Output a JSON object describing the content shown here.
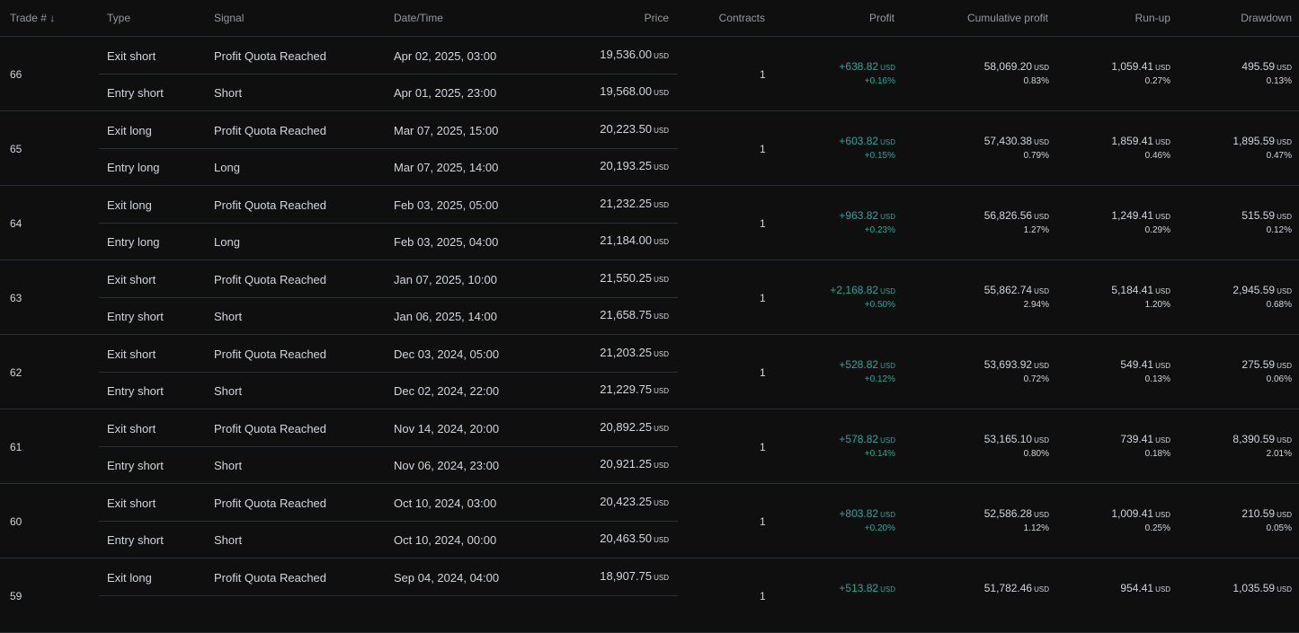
{
  "headers": {
    "trade": "Trade # ↓",
    "type": "Type",
    "signal": "Signal",
    "datetime": "Date/Time",
    "price": "Price",
    "contracts": "Contracts",
    "profit": "Profit",
    "cumulative": "Cumulative profit",
    "runup": "Run-up",
    "drawdown": "Drawdown"
  },
  "currency": "USD",
  "trades": [
    {
      "num": "66",
      "exit": {
        "type": "Exit short",
        "signal": "Profit Quota Reached",
        "datetime": "Apr 02, 2025, 03:00",
        "price": "19,536.00"
      },
      "entry": {
        "type": "Entry short",
        "signal": "Short",
        "datetime": "Apr 01, 2025, 23:00",
        "price": "19,568.00"
      },
      "contracts": "1",
      "profit": "+638.82",
      "profit_pct": "+0.16%",
      "cum": "58,069.20",
      "cum_pct": "0.83%",
      "runup": "1,059.41",
      "runup_pct": "0.27%",
      "dd": "495.59",
      "dd_pct": "0.13%"
    },
    {
      "num": "65",
      "exit": {
        "type": "Exit long",
        "signal": "Profit Quota Reached",
        "datetime": "Mar 07, 2025, 15:00",
        "price": "20,223.50"
      },
      "entry": {
        "type": "Entry long",
        "signal": "Long",
        "datetime": "Mar 07, 2025, 14:00",
        "price": "20,193.25"
      },
      "contracts": "1",
      "profit": "+603.82",
      "profit_pct": "+0.15%",
      "cum": "57,430.38",
      "cum_pct": "0.79%",
      "runup": "1,859.41",
      "runup_pct": "0.46%",
      "dd": "1,895.59",
      "dd_pct": "0.47%"
    },
    {
      "num": "64",
      "exit": {
        "type": "Exit long",
        "signal": "Profit Quota Reached",
        "datetime": "Feb 03, 2025, 05:00",
        "price": "21,232.25"
      },
      "entry": {
        "type": "Entry long",
        "signal": "Long",
        "datetime": "Feb 03, 2025, 04:00",
        "price": "21,184.00"
      },
      "contracts": "1",
      "profit": "+963.82",
      "profit_pct": "+0.23%",
      "cum": "56,826.56",
      "cum_pct": "1.27%",
      "runup": "1,249.41",
      "runup_pct": "0.29%",
      "dd": "515.59",
      "dd_pct": "0.12%"
    },
    {
      "num": "63",
      "exit": {
        "type": "Exit short",
        "signal": "Profit Quota Reached",
        "datetime": "Jan 07, 2025, 10:00",
        "price": "21,550.25"
      },
      "entry": {
        "type": "Entry short",
        "signal": "Short",
        "datetime": "Jan 06, 2025, 14:00",
        "price": "21,658.75"
      },
      "contracts": "1",
      "profit": "+2,168.82",
      "profit_pct": "+0.50%",
      "cum": "55,862.74",
      "cum_pct": "2.94%",
      "runup": "5,184.41",
      "runup_pct": "1.20%",
      "dd": "2,945.59",
      "dd_pct": "0.68%"
    },
    {
      "num": "62",
      "exit": {
        "type": "Exit short",
        "signal": "Profit Quota Reached",
        "datetime": "Dec 03, 2024, 05:00",
        "price": "21,203.25"
      },
      "entry": {
        "type": "Entry short",
        "signal": "Short",
        "datetime": "Dec 02, 2024, 22:00",
        "price": "21,229.75"
      },
      "contracts": "1",
      "profit": "+528.82",
      "profit_pct": "+0.12%",
      "cum": "53,693.92",
      "cum_pct": "0.72%",
      "runup": "549.41",
      "runup_pct": "0.13%",
      "dd": "275.59",
      "dd_pct": "0.06%"
    },
    {
      "num": "61",
      "exit": {
        "type": "Exit short",
        "signal": "Profit Quota Reached",
        "datetime": "Nov 14, 2024, 20:00",
        "price": "20,892.25"
      },
      "entry": {
        "type": "Entry short",
        "signal": "Short",
        "datetime": "Nov 06, 2024, 23:00",
        "price": "20,921.25"
      },
      "contracts": "1",
      "profit": "+578.82",
      "profit_pct": "+0.14%",
      "cum": "53,165.10",
      "cum_pct": "0.80%",
      "runup": "739.41",
      "runup_pct": "0.18%",
      "dd": "8,390.59",
      "dd_pct": "2.01%"
    },
    {
      "num": "60",
      "exit": {
        "type": "Exit short",
        "signal": "Profit Quota Reached",
        "datetime": "Oct 10, 2024, 03:00",
        "price": "20,423.25"
      },
      "entry": {
        "type": "Entry short",
        "signal": "Short",
        "datetime": "Oct 10, 2024, 00:00",
        "price": "20,463.50"
      },
      "contracts": "1",
      "profit": "+803.82",
      "profit_pct": "+0.20%",
      "cum": "52,586.28",
      "cum_pct": "1.12%",
      "runup": "1,009.41",
      "runup_pct": "0.25%",
      "dd": "210.59",
      "dd_pct": "0.05%"
    },
    {
      "num": "59",
      "exit": {
        "type": "Exit long",
        "signal": "Profit Quota Reached",
        "datetime": "Sep 04, 2024, 04:00",
        "price": "18,907.75"
      },
      "entry": {
        "type": "",
        "signal": "",
        "datetime": "",
        "price": ""
      },
      "contracts": "1",
      "profit": "+513.82",
      "profit_pct": "",
      "cum": "51,782.46",
      "cum_pct": "",
      "runup": "954.41",
      "runup_pct": "",
      "dd": "1,035.59",
      "dd_pct": ""
    }
  ]
}
